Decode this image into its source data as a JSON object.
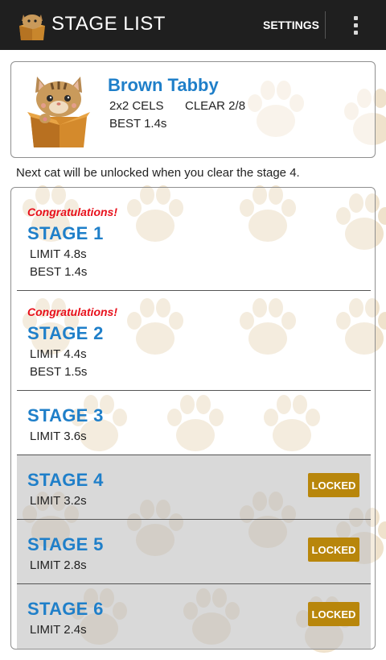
{
  "appbar": {
    "title": "STAGE LIST",
    "settings_label": "SETTINGS"
  },
  "cat": {
    "name": "Brown Tabby",
    "cels": "2x2 CELS",
    "clear": "CLEAR 2/8",
    "best": "BEST 1.4s"
  },
  "unlock_note": "Next cat will be unlocked when you clear the stage 4.",
  "stages": [
    {
      "congrats": "Congratulations!",
      "title": "STAGE 1",
      "limit": "LIMIT 4.8s",
      "best": "BEST 1.4s",
      "locked": false
    },
    {
      "congrats": "Congratulations!",
      "title": "STAGE 2",
      "limit": "LIMIT 4.4s",
      "best": "BEST 1.5s",
      "locked": false
    },
    {
      "title": "STAGE 3",
      "limit": "LIMIT 3.6s",
      "locked": false
    },
    {
      "title": "STAGE 4",
      "limit": "LIMIT 3.2s",
      "locked": true,
      "badge": "LOCKED"
    },
    {
      "title": "STAGE 5",
      "limit": "LIMIT 2.8s",
      "locked": true,
      "badge": "LOCKED"
    },
    {
      "title": "STAGE 6",
      "limit": "LIMIT 2.4s",
      "locked": true,
      "badge": "LOCKED"
    }
  ],
  "colors": {
    "appbar": "#1f1f1f",
    "accent_blue": "#1f7fc9",
    "congrats_red": "#e8101b",
    "locked_gold": "#b8860b",
    "paw": "#e2cba4"
  },
  "icons": {
    "app": "cat-in-box-icon",
    "overflow": "overflow-menu-icon",
    "background": "paw-print-pattern"
  }
}
